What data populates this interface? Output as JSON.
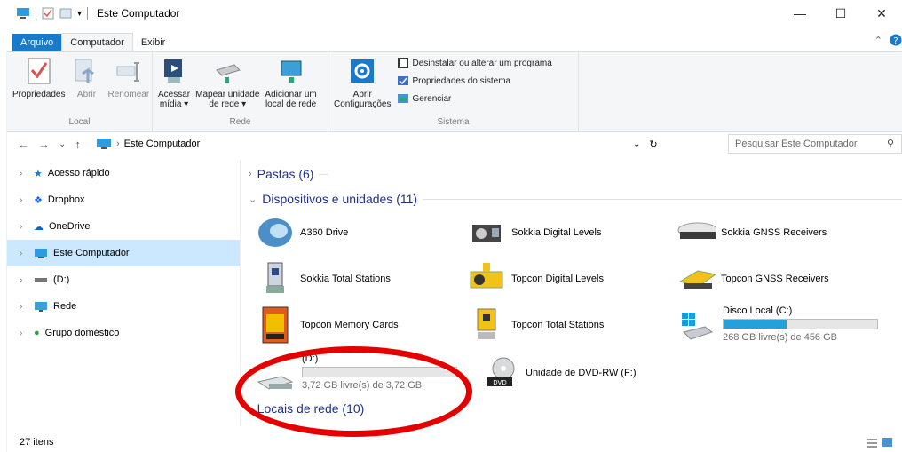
{
  "window": {
    "title": "Este Computador"
  },
  "ribbon_tabs": [
    "Arquivo",
    "Computador",
    "Exibir"
  ],
  "ribbon": {
    "local": {
      "label": "Local",
      "items": [
        "Propriedades",
        "Abrir",
        "Renomear"
      ]
    },
    "rede": {
      "label": "Rede",
      "items": [
        {
          "l1": "Acessar",
          "l2": "mídia ▾"
        },
        {
          "l1": "Mapear unidade",
          "l2": "de rede ▾"
        },
        {
          "l1": "Adicionar um",
          "l2": "local de rede"
        }
      ]
    },
    "sistema": {
      "label": "Sistema",
      "open": {
        "l1": "Abrir",
        "l2": "Configurações"
      },
      "small": [
        "Desinstalar ou alterar um programa",
        "Propriedades do sistema",
        "Gerenciar"
      ]
    }
  },
  "address": {
    "path": "Este Computador",
    "search_placeholder": "Pesquisar Este Computador"
  },
  "sidebar": [
    "Acesso rápido",
    "Dropbox",
    "OneDrive",
    "Este Computador",
    "(D:)",
    "Rede",
    "Grupo doméstico"
  ],
  "groups": {
    "folders": "Pastas (6)",
    "devices": "Dispositivos e unidades (11)",
    "network": "Locais de rede (10)"
  },
  "devices": [
    "A360 Drive",
    "Sokkia Digital Levels",
    "Sokkia GNSS Receivers",
    "Sokkia Total Stations",
    "Topcon Digital Levels",
    "Topcon GNSS Receivers",
    "Topcon Memory Cards",
    "Topcon Total Stations"
  ],
  "drives": {
    "c": {
      "name": "Disco Local (C:)",
      "free": "268 GB livre(s) de 456 GB",
      "used_fraction": 0.41
    },
    "d": {
      "name": "(D:)",
      "free": "3,72 GB livre(s) de 3,72 GB",
      "used_fraction": 0.0
    },
    "f": {
      "name": "Unidade de DVD-RW (F:)"
    }
  },
  "status": {
    "count": "27 itens"
  },
  "colors": {
    "accent": "#1979ca",
    "selection": "#cce8ff",
    "bar": "#26a0da",
    "annotation": "#e50000"
  }
}
